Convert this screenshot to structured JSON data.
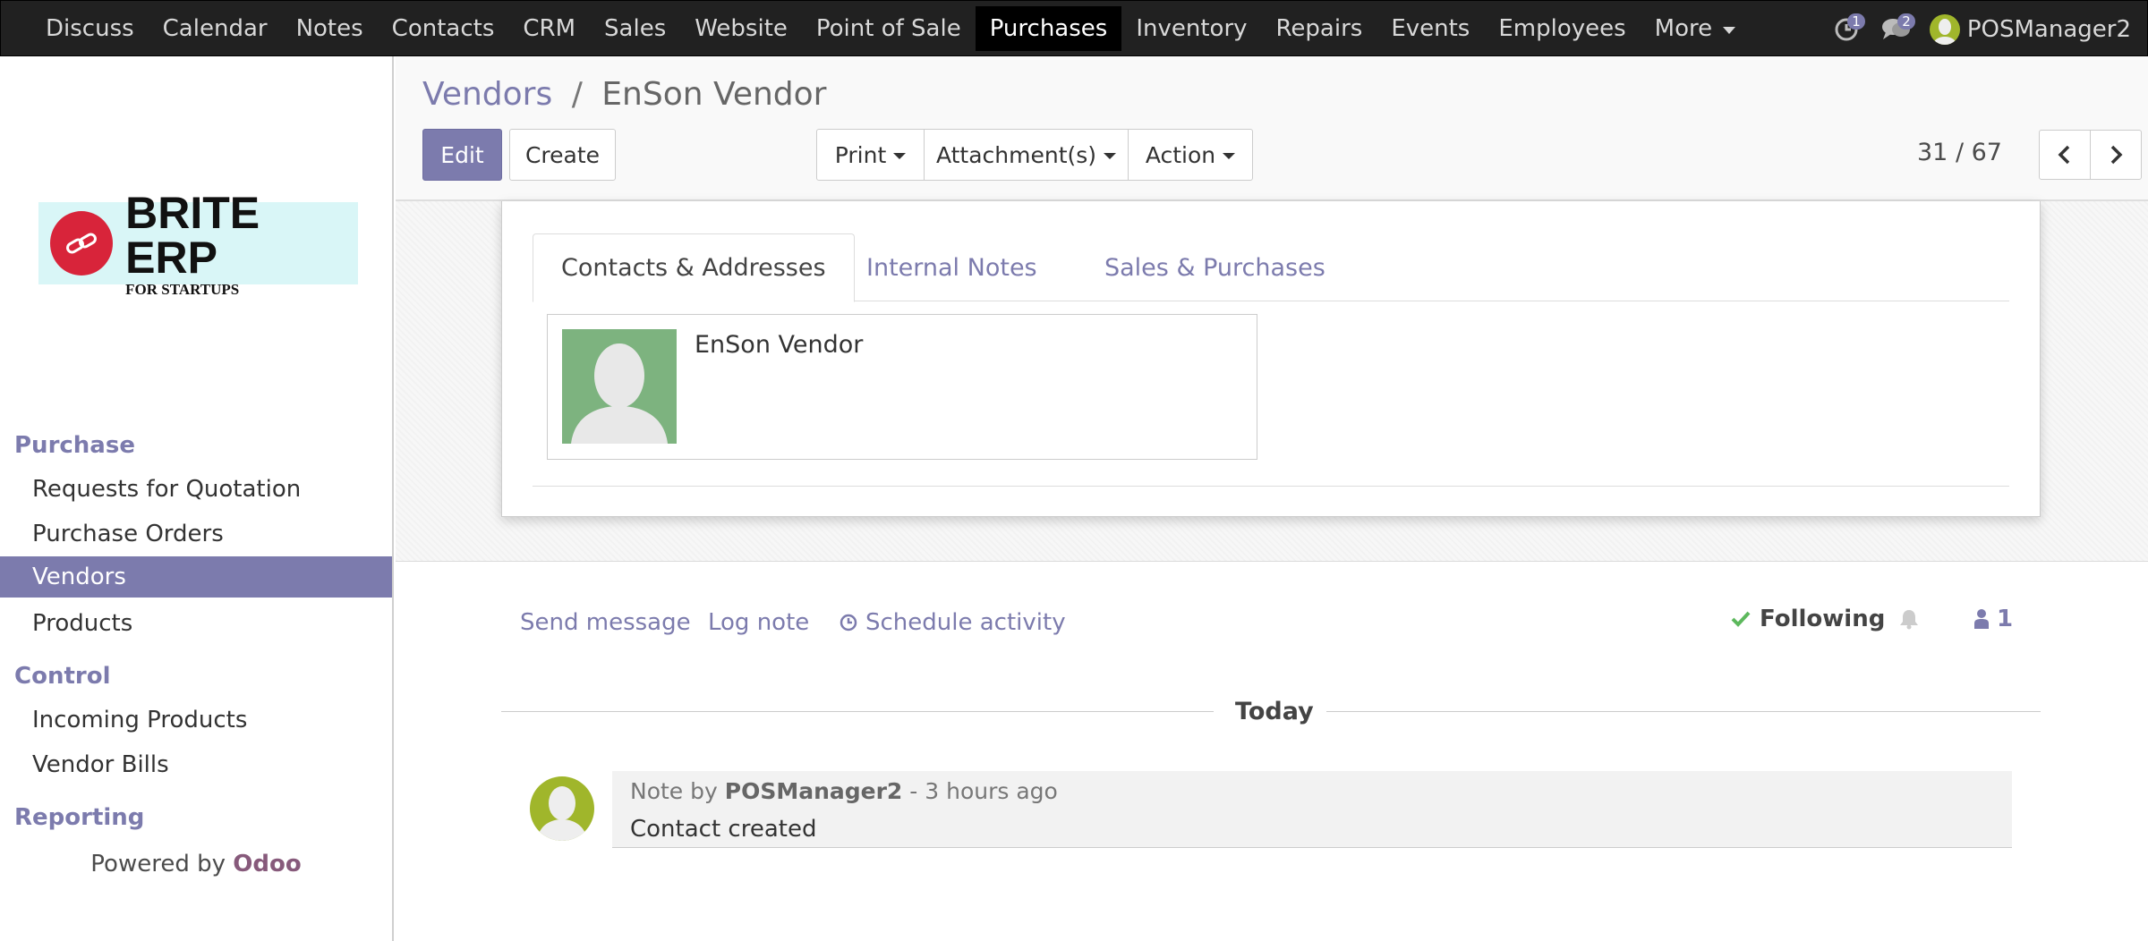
{
  "topbar": {
    "menu": [
      {
        "label": "Discuss"
      },
      {
        "label": "Calendar"
      },
      {
        "label": "Notes"
      },
      {
        "label": "Contacts"
      },
      {
        "label": "CRM"
      },
      {
        "label": "Sales"
      },
      {
        "label": "Website"
      },
      {
        "label": "Point of Sale"
      },
      {
        "label": "Purchases",
        "active": true
      },
      {
        "label": "Inventory"
      },
      {
        "label": "Repairs"
      },
      {
        "label": "Events"
      },
      {
        "label": "Employees"
      },
      {
        "label": "More"
      }
    ],
    "activity_badge": "1",
    "messages_badge": "2",
    "user_name": "POSManager2",
    "icons": {
      "activity": "clock-icon",
      "messages": "chat-icon"
    }
  },
  "sidebar": {
    "logo": {
      "title": "BRITE ERP",
      "subtitle": "FOR STARTUPS"
    },
    "sections": [
      {
        "label": "Purchase",
        "items": [
          {
            "label": "Requests for Quotation"
          },
          {
            "label": "Purchase Orders"
          },
          {
            "label": "Vendors",
            "active": true
          },
          {
            "label": "Products"
          }
        ]
      },
      {
        "label": "Control",
        "items": [
          {
            "label": "Incoming Products"
          },
          {
            "label": "Vendor Bills"
          }
        ]
      },
      {
        "label": "Reporting",
        "items": []
      }
    ],
    "powered_prefix": "Powered by ",
    "powered_brand": "Odoo"
  },
  "control_panel": {
    "breadcrumb_parent": "Vendors",
    "breadcrumb_separator": "/",
    "breadcrumb_current": "EnSon Vendor",
    "edit_label": "Edit",
    "create_label": "Create",
    "print_label": "Print",
    "attachments_label": "Attachment(s)",
    "action_label": "Action",
    "pager_value": "31 / 67"
  },
  "form": {
    "tabs": [
      {
        "label": "Contacts & Addresses",
        "active": true
      },
      {
        "label": "Internal Notes"
      },
      {
        "label": "Sales & Purchases"
      }
    ],
    "contact_card_name": "EnSon Vendor"
  },
  "chatter": {
    "send_message": "Send message",
    "log_note": "Log note",
    "schedule_activity": "Schedule activity",
    "following": "Following",
    "followers_count": "1",
    "date_separator": "Today",
    "message": {
      "prefix": "Note by",
      "author": "POSManager2",
      "time": "- 3 hours ago",
      "body": "Contact created"
    }
  },
  "colors": {
    "accent": "#7c7bad",
    "navbar": "#212121",
    "odoo": "#875a7b",
    "following_check": "#5cb85c"
  }
}
